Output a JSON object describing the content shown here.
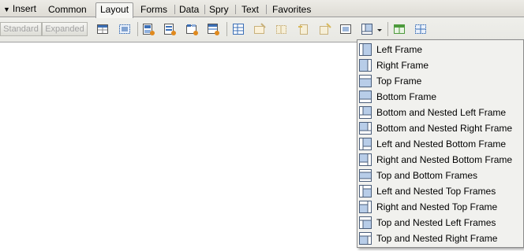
{
  "panel": {
    "title": "Insert",
    "collapse_icon": "triangle-down-icon"
  },
  "tabs": [
    {
      "label": "Common",
      "active": false
    },
    {
      "label": "Layout",
      "active": true
    },
    {
      "label": "Forms",
      "active": false
    },
    {
      "label": "Data",
      "active": false
    },
    {
      "label": "Spry",
      "active": false
    },
    {
      "label": "Text",
      "active": false
    },
    {
      "label": "Favorites",
      "active": false
    }
  ],
  "toolbar": {
    "standard_label": "Standard",
    "expanded_label": "Expanded",
    "tools": [
      "table-icon",
      "draw-layer-icon",
      "insert-div-tag-icon",
      "spry-menu-bar-icon",
      "spry-tabbed-panels-icon",
      "spry-accordion-icon",
      "layout-table-icon",
      "draw-cell-icon",
      "insert-column-icon",
      "insert-row-icon",
      "iframe-icon",
      "frames-icon",
      "dropdown-arrow-icon",
      "layout-mode-icon",
      "standard-mode-icon"
    ]
  },
  "frames_menu": {
    "items": [
      {
        "label": "Left Frame",
        "icon": "left-frame-icon"
      },
      {
        "label": "Right Frame",
        "icon": "right-frame-icon"
      },
      {
        "label": "Top Frame",
        "icon": "top-frame-icon"
      },
      {
        "label": "Bottom Frame",
        "icon": "bottom-frame-icon"
      },
      {
        "label": "Bottom and Nested Left Frame",
        "icon": "bottom-nested-left-frame-icon"
      },
      {
        "label": "Bottom and Nested Right Frame",
        "icon": "bottom-nested-right-frame-icon"
      },
      {
        "label": "Left and Nested Bottom Frame",
        "icon": "left-nested-bottom-frame-icon"
      },
      {
        "label": "Right and Nested Bottom Frame",
        "icon": "right-nested-bottom-frame-icon"
      },
      {
        "label": "Top and Bottom Frames",
        "icon": "top-bottom-frames-icon"
      },
      {
        "label": "Left and Nested Top Frames",
        "icon": "left-nested-top-frames-icon"
      },
      {
        "label": "Right and Nested Top Frame",
        "icon": "right-nested-top-frame-icon"
      },
      {
        "label": "Top and Nested Left Frames",
        "icon": "top-nested-left-frames-icon"
      },
      {
        "label": "Top and Nested Right Frame",
        "icon": "top-nested-right-frame-icon"
      }
    ]
  },
  "colors": {
    "frame_fill": "#b8cde8",
    "frame_border": "#4a5d7a",
    "tool_blue": "#3b6fb6",
    "tool_orange": "#e08a1e",
    "tool_green": "#4d9a3c",
    "disabled_text": "#a2a2a2"
  }
}
